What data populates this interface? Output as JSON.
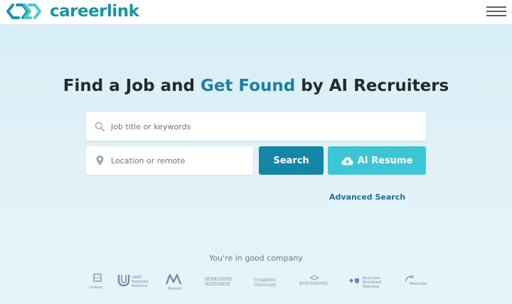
{
  "brand": {
    "name": "careerlink",
    "primary_color": "#1596a6",
    "accent_color": "#1a7fa4",
    "logo_icon": "chain-link-logo-icon"
  },
  "header": {
    "menu_icon": "hamburger-menu-icon"
  },
  "hero": {
    "part1": "Find a Job",
    "part2": "and",
    "part3": "Get Found",
    "part4": "by AI Recruiters"
  },
  "search": {
    "keywords_placeholder": "Job title or keywords",
    "keywords_value": "",
    "keywords_icon": "search-icon",
    "location_placeholder": "Location or remote",
    "location_value": "",
    "location_icon": "map-pin-icon",
    "search_label": "Search",
    "ai_resume_label": "AI Resume",
    "ai_resume_icon": "cloud-upload-icon",
    "advanced_label": "Advanced Search"
  },
  "companies": {
    "label": "You're in good company",
    "logos": [
      "Lindsay",
      "UNMC Nebraska Medicine",
      "Marriott",
      "Berkshire Hathaway",
      "Creighton University",
      "Borsheims",
      "BlueCross BlueShield Nebraska",
      "Methodist"
    ]
  }
}
